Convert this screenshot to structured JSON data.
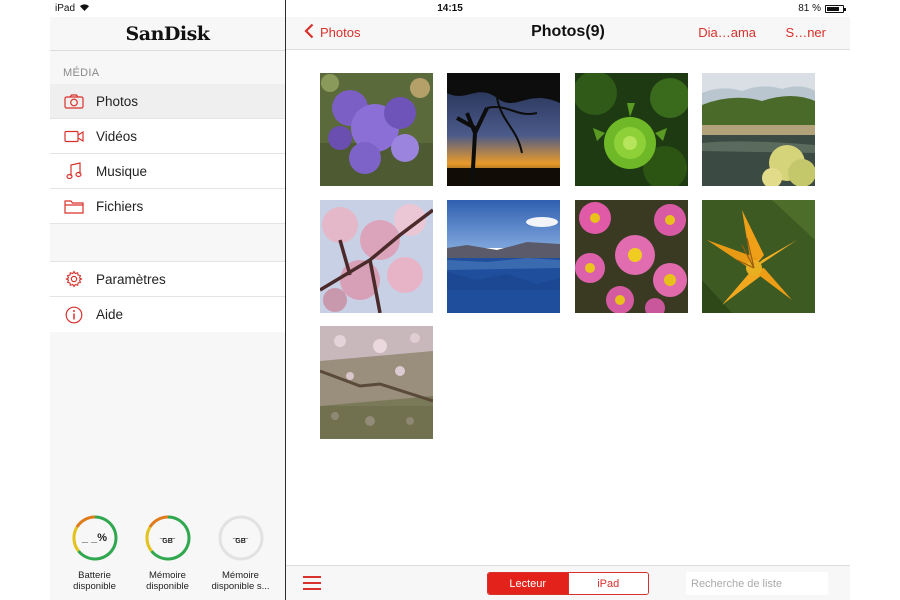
{
  "status": {
    "device": "iPad",
    "time": "14:15",
    "battery_text": "81 %",
    "battery_level": 0.81
  },
  "sidebar": {
    "brand": "SanDisk",
    "section_label": "MÉDIA",
    "items": [
      {
        "label": "Photos",
        "icon": "camera-icon",
        "active": true
      },
      {
        "label": "Vidéos",
        "icon": "video-camera-icon",
        "active": false
      },
      {
        "label": "Musique",
        "icon": "music-note-icon",
        "active": false
      },
      {
        "label": "Fichiers",
        "icon": "folder-icon",
        "active": false
      }
    ],
    "settings": [
      {
        "label": "Paramètres",
        "icon": "gear-icon"
      },
      {
        "label": "Aide",
        "icon": "info-icon"
      }
    ],
    "gauges": [
      {
        "value": "_ _%",
        "caption_line1": "Batterie",
        "caption_line2": "disponible"
      },
      {
        "value": "_ _",
        "unit": "GB",
        "caption_line1": "Mémoire",
        "caption_line2": "disponible"
      },
      {
        "value": "_ _",
        "unit": "GB",
        "caption_line1": "Mémoire",
        "caption_line2": "disponible s..."
      }
    ]
  },
  "navbar": {
    "back_label": "Photos",
    "title": "Photos(9)",
    "slideshow_label": "Dia…ama",
    "select_label": "S…ner"
  },
  "photos": [
    {
      "subject": "purple-flowers"
    },
    {
      "subject": "tree-sunset"
    },
    {
      "subject": "green-plant"
    },
    {
      "subject": "lake-hills"
    },
    {
      "subject": "pink-blossoms"
    },
    {
      "subject": "crater-lake"
    },
    {
      "subject": "pink-daisies"
    },
    {
      "subject": "orange-lily"
    },
    {
      "subject": "petals-on-ground"
    }
  ],
  "toolbar": {
    "segments": [
      "Lecteur",
      "iPad"
    ],
    "active_segment": 0,
    "search_placeholder": "Recherche de liste",
    "search_value": ""
  },
  "colors": {
    "accent": "#d9312b",
    "accent_fill": "#e3231b"
  }
}
